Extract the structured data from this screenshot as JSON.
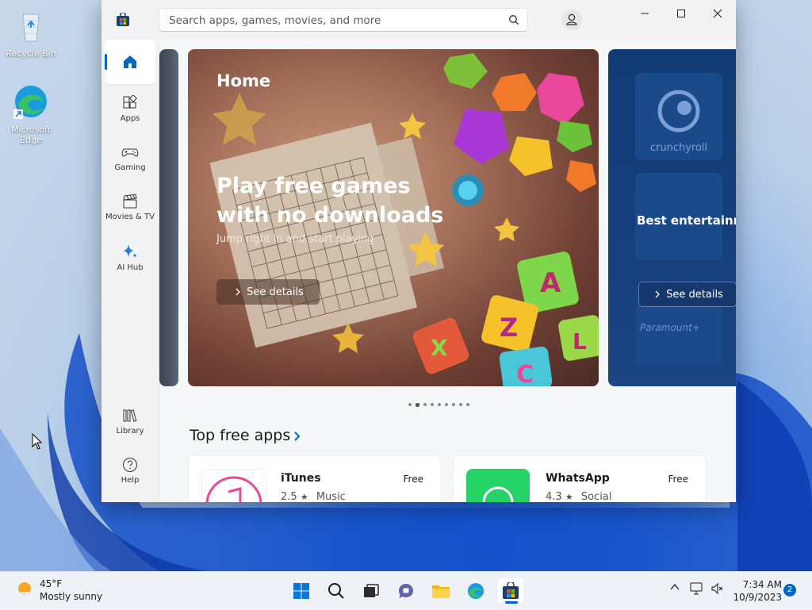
{
  "desktop": {
    "icons": [
      {
        "label": "Recycle Bin"
      },
      {
        "label": "Microsoft\nEdge"
      }
    ]
  },
  "window": {
    "search_placeholder": "Search apps, games, movies, and more",
    "nav": [
      {
        "label": "Home",
        "icon": "home-icon"
      },
      {
        "label": "Apps",
        "icon": "apps-icon"
      },
      {
        "label": "Gaming",
        "icon": "gamepad-icon"
      },
      {
        "label": "Movies & TV",
        "icon": "clapperboard-icon"
      },
      {
        "label": "AI Hub",
        "icon": "sparkle-icon"
      },
      {
        "label": "Library",
        "icon": "library-icon"
      },
      {
        "label": "Help",
        "icon": "help-icon"
      }
    ],
    "hero": {
      "title": "Home",
      "headline": "Play free games with no downloads",
      "subtitle": "Jump right in and start playing",
      "button": "See details",
      "right_title": "Best entertainment apps",
      "right_button": "See details",
      "right_brands": [
        "crunchyroll",
        "Paramount+"
      ],
      "dot_count": 9,
      "active_dot": 1
    },
    "section_title": "Top free apps",
    "apps": [
      {
        "name": "iTunes",
        "rating": "2.5",
        "category": "Music",
        "price": "Free",
        "color": "#ffffff"
      },
      {
        "name": "WhatsApp",
        "rating": "4.3",
        "category": "Social",
        "price": "Free",
        "color": "#25d366"
      }
    ]
  },
  "taskbar": {
    "temperature": "45°F",
    "condition": "Mostly sunny",
    "time": "7:34 AM",
    "date": "10/9/2023",
    "notifications": "2"
  },
  "colors": {
    "accent": "#0067c0",
    "store_blue": "#0067c0"
  }
}
